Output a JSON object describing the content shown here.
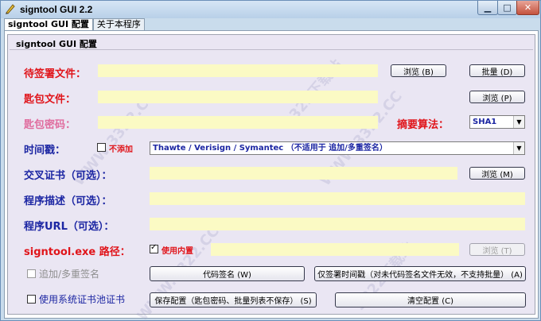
{
  "window": {
    "title": "signtool GUI 2.2",
    "icon": "signtool-app-icon"
  },
  "tabs": [
    {
      "label": "signtool GUI 配置"
    },
    {
      "label": "关于本程序"
    }
  ],
  "group": {
    "title": "signtool GUI 配置"
  },
  "rows": {
    "files": {
      "label": "待签署文件：",
      "browse": "浏览 (B)",
      "batch": "批量 (D)"
    },
    "pvk": {
      "label": "匙包文件：",
      "browse": "浏览 (P)"
    },
    "password": {
      "label": "匙包密码：",
      "hash_label": "摘要算法：",
      "hash_value": "SHA1"
    },
    "timestamp": {
      "label": "时间戳：",
      "no_add": "不添加",
      "value": "Thawte / Verisign / Symantec    （不适用于 追加/多重签名）"
    },
    "cross": {
      "label": "交叉证书（可选）：",
      "browse": "浏览 (M)"
    },
    "desc": {
      "label": "程序描述（可选）："
    },
    "url": {
      "label": "程序URL（可选）："
    },
    "signtool": {
      "label": "signtool.exe 路径：",
      "builtin": "使用内置",
      "browse": "浏览 (T)"
    }
  },
  "options": {
    "append": "追加/多重签名",
    "system_store": "使用系统证书池证书"
  },
  "buttons": {
    "sign": "代码签名 (W)",
    "timestamp_only": "仅签署时间戳（对未代码签名文件无效，不支持批量） (A)",
    "save": "保存配置（匙包密码、批量列表不保存） (S)",
    "clear": "清空配置 (C)"
  },
  "watermarks": [
    "3322下载站",
    "WWW.3322.CC"
  ],
  "colors": {
    "required": "#e0141a",
    "optional": "#1c26a3",
    "password": "#e06c9e",
    "field_bg": "#fbfac4"
  }
}
